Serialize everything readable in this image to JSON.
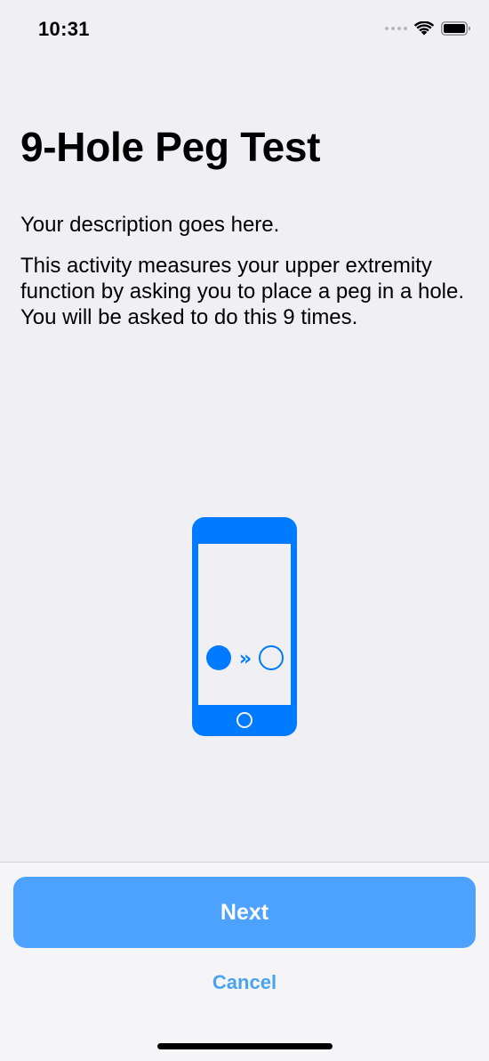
{
  "status_bar": {
    "time": "10:31",
    "icons": [
      "signal-icon",
      "wifi-icon",
      "battery-icon"
    ]
  },
  "title": "9-Hole Peg Test",
  "description": {
    "line1": "Your description goes here.",
    "line2": "This activity measures your upper extremity function by asking you to place a peg in a hole. You will be asked to do this 9 times."
  },
  "illustration": {
    "icon": "phone-peg-icon",
    "arrow_glyph": "»"
  },
  "footer": {
    "next_label": "Next",
    "cancel_label": "Cancel"
  },
  "colors": {
    "accent": "#007aff",
    "button_bg": "#4da1ff",
    "cancel_text": "#4aa3ef",
    "background": "#efeff4"
  }
}
